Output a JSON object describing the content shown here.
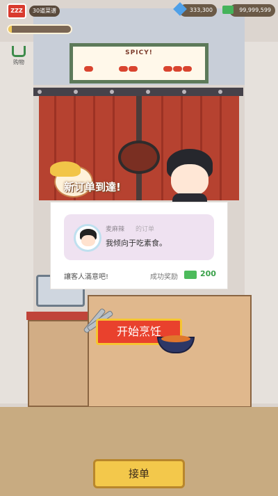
{
  "hud": {
    "level_badge": "ZZZ",
    "count_label": "30道菜谱",
    "gems": "333,300",
    "money": "99,999,599",
    "progress": 0.05
  },
  "shop": {
    "label": "购物"
  },
  "sign": {
    "title": "SPICY!"
  },
  "scene": {
    "arrival_text": "新订单到達!"
  },
  "order": {
    "customer_name": "麦麻辣",
    "customer_sub": "的订单",
    "request": "我倾向于吃素食。",
    "satisfy_text": "讓客人滿意吧!",
    "reward_label": "成功奖励",
    "reward_value": "200"
  },
  "buttons": {
    "start_cooking": "开始烹饪",
    "accept_order": "接单"
  },
  "colors": {
    "accent_red": "#e9412d",
    "accent_yellow": "#f3c84b",
    "reward_green": "#3aa14a"
  },
  "icons": [
    "gem-icon",
    "cash-icon",
    "shop-basket-icon",
    "tongs-icon",
    "hotpot-icon"
  ]
}
